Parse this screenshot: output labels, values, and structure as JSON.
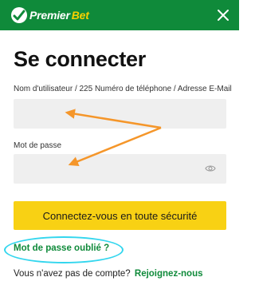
{
  "header": {
    "brand_prefix": "Premier",
    "brand_suffix": "Bet",
    "colors": {
      "background": "#0f8a3a",
      "accent": "#f7d000"
    }
  },
  "login": {
    "title": "Se connecter",
    "username_label": "Nom d'utilisateur / 225 Numéro de téléphone / Adresse E-Mail",
    "username_value": "",
    "password_label": "Mot de passe",
    "password_value": "",
    "submit_label": "Connectez-vous en toute sécurité",
    "forgot_password_label": "Mot de passe oublié ?",
    "no_account_text": "Vous n'avez pas de compte?",
    "join_label": "Rejoignez-nous"
  },
  "colors": {
    "submit_button": "#f8d114",
    "link": "#0f8a3a",
    "annotation_arrow": "#f5962a",
    "annotation_highlight": "#33d6ee"
  },
  "icons": {
    "close": "close-icon",
    "password_toggle": "eye-icon",
    "brand": "logo-icon"
  }
}
